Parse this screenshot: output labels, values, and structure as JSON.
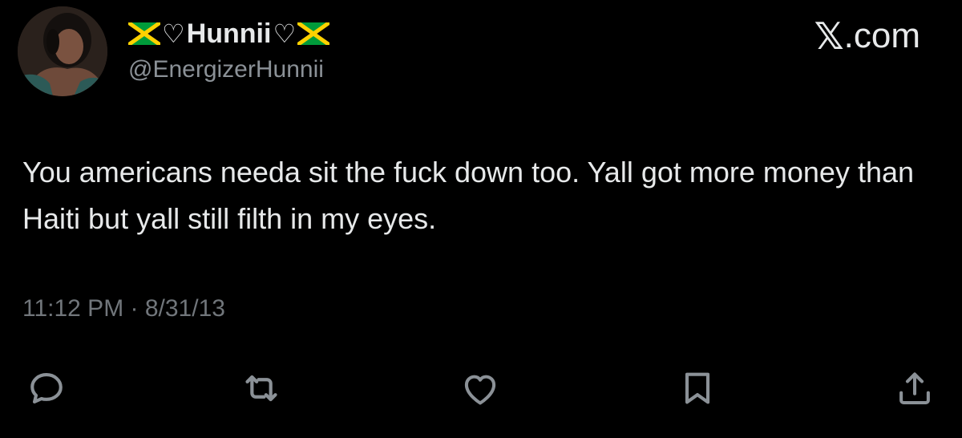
{
  "author": {
    "display_name": "Hunnii",
    "heart_left": "♡",
    "heart_right": "♡",
    "flag_icon": "jamaica-flag",
    "handle": "@EnergizerHunnii"
  },
  "brand": {
    "x_mark": "𝕏",
    "domain": ".com"
  },
  "tweet": {
    "text": "You americans needa sit the fuck down too. Yall got more money than Haiti but yall still filth in my eyes.",
    "timestamp": "11:12 PM · 8/31/13"
  },
  "actions": [
    {
      "name": "reply",
      "icon": "speech-bubble-icon"
    },
    {
      "name": "retweet",
      "icon": "retweet-icon"
    },
    {
      "name": "like",
      "icon": "heart-icon"
    },
    {
      "name": "bookmark",
      "icon": "bookmark-icon"
    },
    {
      "name": "share",
      "icon": "share-icon"
    }
  ],
  "colors": {
    "background": "#000000",
    "text": "#e7e9ea",
    "secondary_text": "#8b9197",
    "icon": "#8b9197",
    "flag_green": "#009b3a",
    "flag_gold": "#fed100",
    "flag_black": "#000000"
  }
}
